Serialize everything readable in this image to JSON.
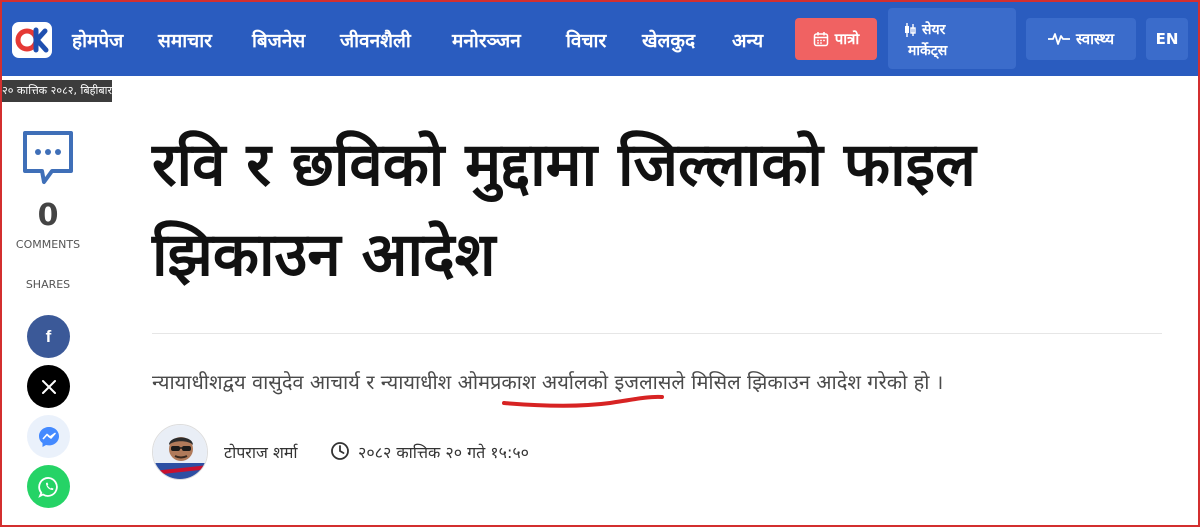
{
  "brand": {
    "colors": {
      "header": "#2a5cbf",
      "patro": "#f06262",
      "accent_underline": "#d72323"
    }
  },
  "nav": {
    "logo_icon": "ok-logo-icon",
    "items": [
      {
        "label": "होमपेज"
      },
      {
        "label": "समाचार"
      },
      {
        "label": "बिजनेस"
      },
      {
        "label": "जीवनशैली"
      },
      {
        "label": "मनोरञ्जन"
      },
      {
        "label": "विचार"
      },
      {
        "label": "खेलकुद"
      },
      {
        "label": "अन्य"
      }
    ],
    "patro": {
      "label": "पात्रो",
      "icon": "calendar-icon"
    },
    "share_market": {
      "line1": "सेयर",
      "line2": "मार्केट्स",
      "icon": "candlestick-icon"
    },
    "health": {
      "label": "स्वास्थ्य",
      "icon": "pulse-icon"
    },
    "lang": {
      "label": "EN"
    }
  },
  "date_bar": "२० कात्तिक २०८२, बिहीबार",
  "rail": {
    "comment_count": "0",
    "comments_label": "COMMENTS",
    "shares_label": "SHARES",
    "share_buttons": [
      {
        "name": "facebook",
        "color": "#3b5998",
        "icon": "facebook-icon"
      },
      {
        "name": "x",
        "color": "#000000",
        "icon": "x-icon"
      },
      {
        "name": "messenger",
        "color": "#448aff",
        "icon": "messenger-icon"
      },
      {
        "name": "whatsapp",
        "color": "#25d366",
        "icon": "whatsapp-icon"
      }
    ]
  },
  "article": {
    "headline": "रवि र छविको मुद्दामा जिल्लाको फाइल झिकाउन आदेश",
    "summary": "न्यायाधीशद्वय वासुदेव आचार्य र न्यायाधीश ओमप्रकाश अर्यालको इजलासले मिसिल झिकाउन आदेश गरेको हो ।",
    "author": "टोपराज शर्मा",
    "published": "२०८२ कात्तिक २० गते १५:५०"
  }
}
